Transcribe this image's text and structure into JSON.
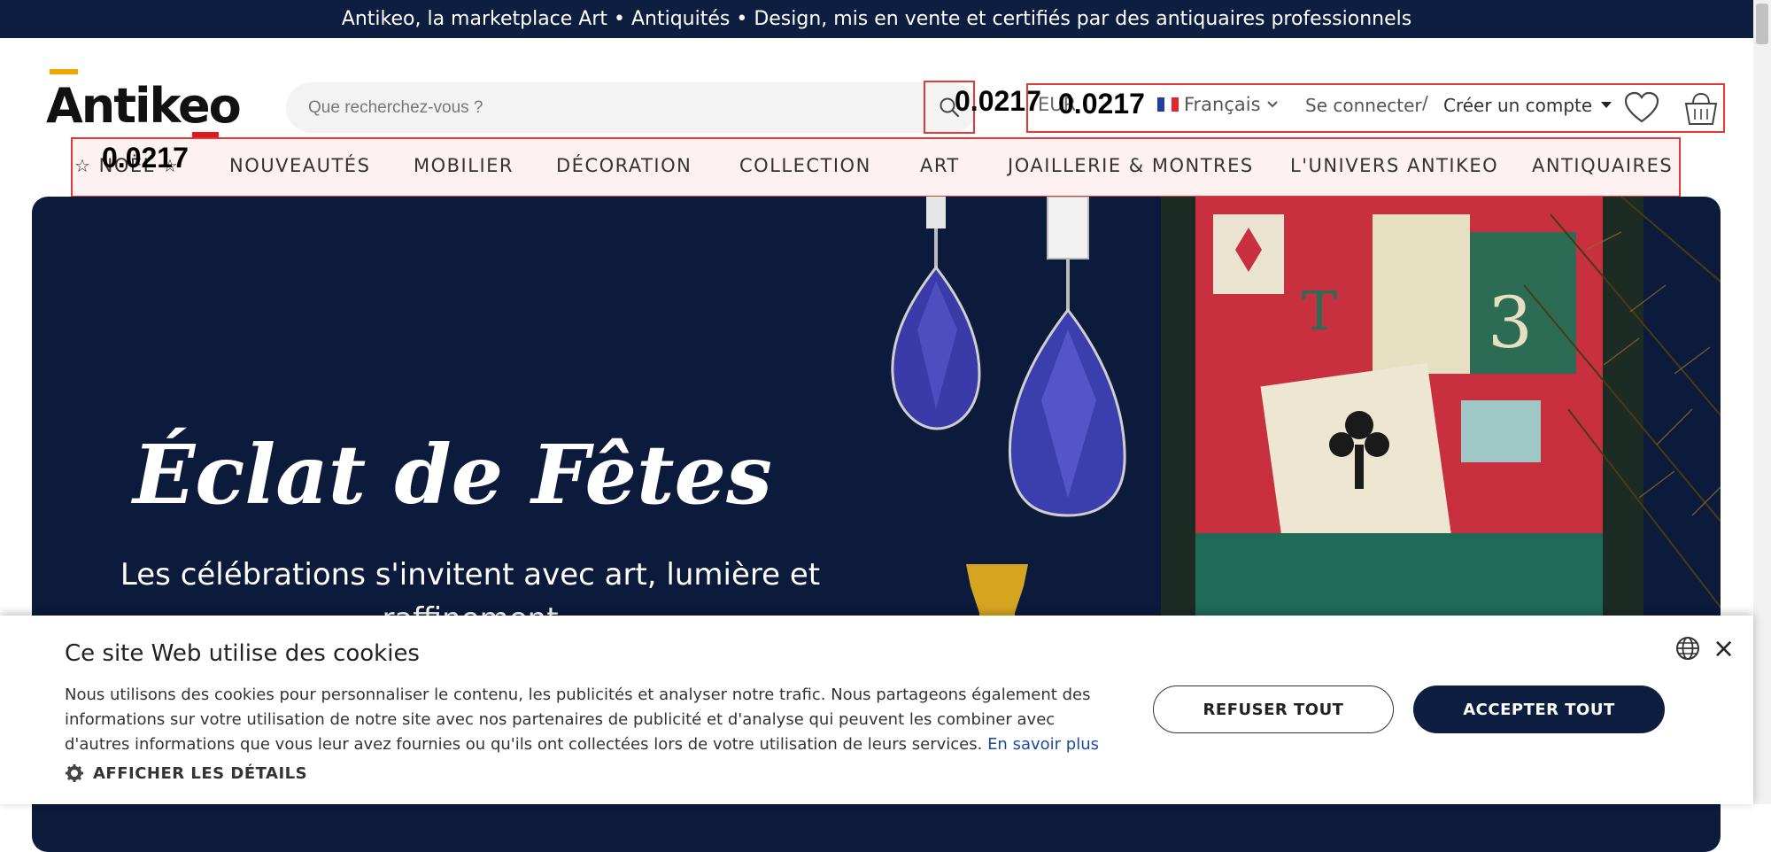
{
  "promo": {
    "text": "Antikeo, la marketplace Art • Antiquités • Design, mis en vente et certifiés par des antiquaires professionnels"
  },
  "logo": {
    "text": "Antikeo"
  },
  "search": {
    "placeholder": "Que recherchez-vous ?",
    "icon": "search-icon"
  },
  "overlays": {
    "search_num": "0.0217",
    "util_num": "0.0217",
    "nav_num": "0.0217"
  },
  "header": {
    "currency": "EUR",
    "language": "Français",
    "login": "Se connecter",
    "separator": "/",
    "create_account": "Créer un compte"
  },
  "nav": {
    "items": [
      "NOËL",
      "NOUVEAUTÉS",
      "MOBILIER",
      "DÉCORATION",
      "COLLECTION",
      "ART",
      "JOAILLERIE & MONTRES",
      "L'UNIVERS ANTIKEO",
      "ANTIQUAIRES"
    ]
  },
  "hero": {
    "title": "Éclat de Fêtes",
    "subtitle": "Les célébrations s'invitent avec art, lumière et raffinement"
  },
  "cookie": {
    "title": "Ce site Web utilise des cookies",
    "text": "Nous utilisons des cookies pour personnaliser le contenu, les publicités et analyser notre trafic. Nous partageons également des informations sur votre utilisation de notre site avec nos partenaires de publicité et d'analyse qui peuvent les combiner avec d'autres informations que vous leur avez fournies ou qu'ils ont collectées lors de votre utilisation de leurs services.",
    "link": "En savoir plus",
    "details": "AFFICHER LES DÉTAILS",
    "refuse": "REFUSER TOUT",
    "accept": "ACCEPTER TOUT",
    "close": "×"
  },
  "colors": {
    "navy": "#0d1e40",
    "highlight": "#e53935",
    "accent_yellow": "#f0a500",
    "accent_red": "#e0161e"
  }
}
